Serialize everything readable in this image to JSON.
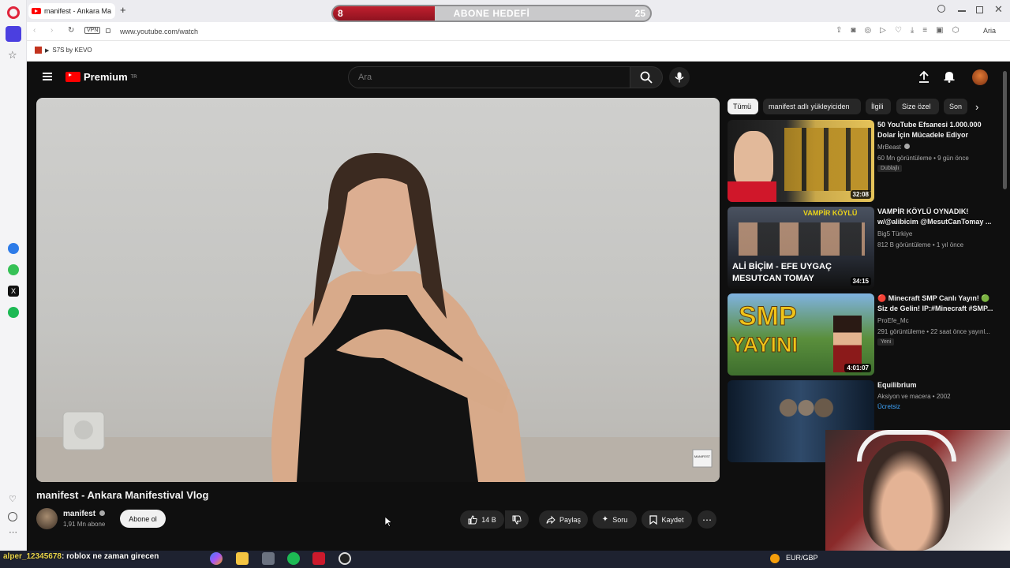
{
  "browser": {
    "tab_title": "manifest - Ankara Ma",
    "new_tab_glyph": "+",
    "url": "www.youtube.com/watch",
    "vpn_label": "VPN",
    "bookmark": "S7S by KEVO",
    "ai_label": "Aria"
  },
  "goal": {
    "title": "ABONE HEDEFİ",
    "current": "8",
    "target": "25",
    "progress": 0.32
  },
  "youtube": {
    "logo": "Premium",
    "region": "TR",
    "search_placeholder": "Ara"
  },
  "video": {
    "title": "manifest - Ankara Manifestival Vlog",
    "watermark": "MANIFEST",
    "channel_name": "manifest",
    "channel_subs": "1,91 Mn abone",
    "subscribe_label": "Abone ol",
    "likes": "14 B",
    "share_label": "Paylaş",
    "ask_label": "Soru",
    "save_label": "Kaydet",
    "more_glyph": "⋯"
  },
  "chips": [
    "Tümü",
    "manifest adlı yükleyiciden",
    "İlgili",
    "Size özel",
    "Son"
  ],
  "recommendations": [
    {
      "title": "50 YouTube Efsanesi 1.000.000 Dolar İçin Mücadele Ediyor",
      "channel": "MrBeast",
      "verified": true,
      "meta": "60 Mn görüntüleme • 9 gün önce",
      "badge": "Dublajlı",
      "duration": "32:08",
      "thumb_colors": [
        "#1a1a1a",
        "#c9a84a"
      ]
    },
    {
      "title": "VAMPİR KÖYLÜ OYNADIK! w/@alibicim @MesutCanTomay ...",
      "channel": "Big5 Türkiye",
      "verified": false,
      "meta": "812 B görüntüleme • 1 yıl önce",
      "badge": "",
      "duration": "34:15",
      "thumb_text": [
        "VAMPİR KÖYLÜ",
        "ALİ BİÇİM - EFE UYGAÇ",
        "MESUTCAN TOMAY"
      ],
      "thumb_colors": [
        "#2a2f3a",
        "#e9d21a"
      ]
    },
    {
      "title": "🔴 Minecraft SMP Canlı Yayın! 🟢 Siz de Gelin! IP:#Minecraft #SMP...",
      "channel": "ProEfe_Mc",
      "verified": false,
      "meta": "291 görüntüleme • 22 saat önce yayınl...",
      "badge": "Yeni",
      "duration": "4:01:07",
      "thumb_text": [
        "SMP",
        "YAYINI"
      ],
      "thumb_colors": [
        "#3e6e2e",
        "#f0c419"
      ]
    },
    {
      "title": "Equilibrium",
      "channel": "Aksiyon ve macera • 2002",
      "verified": false,
      "meta": "Ücretsiz",
      "badge": "",
      "duration": "",
      "thumb_colors": [
        "#0d1a2a",
        "#2f4a6a"
      ]
    }
  ],
  "stream_overlay": {
    "user": "alper_12345678",
    "message": ": roblox ne zaman girecen"
  },
  "taskbar": {
    "fx": "EUR/GBP"
  },
  "colors": {
    "yt_red": "#ff0000",
    "goal_red": "#c0202e",
    "dark_bg": "#0f0f0f",
    "chip_bg": "#272727"
  }
}
